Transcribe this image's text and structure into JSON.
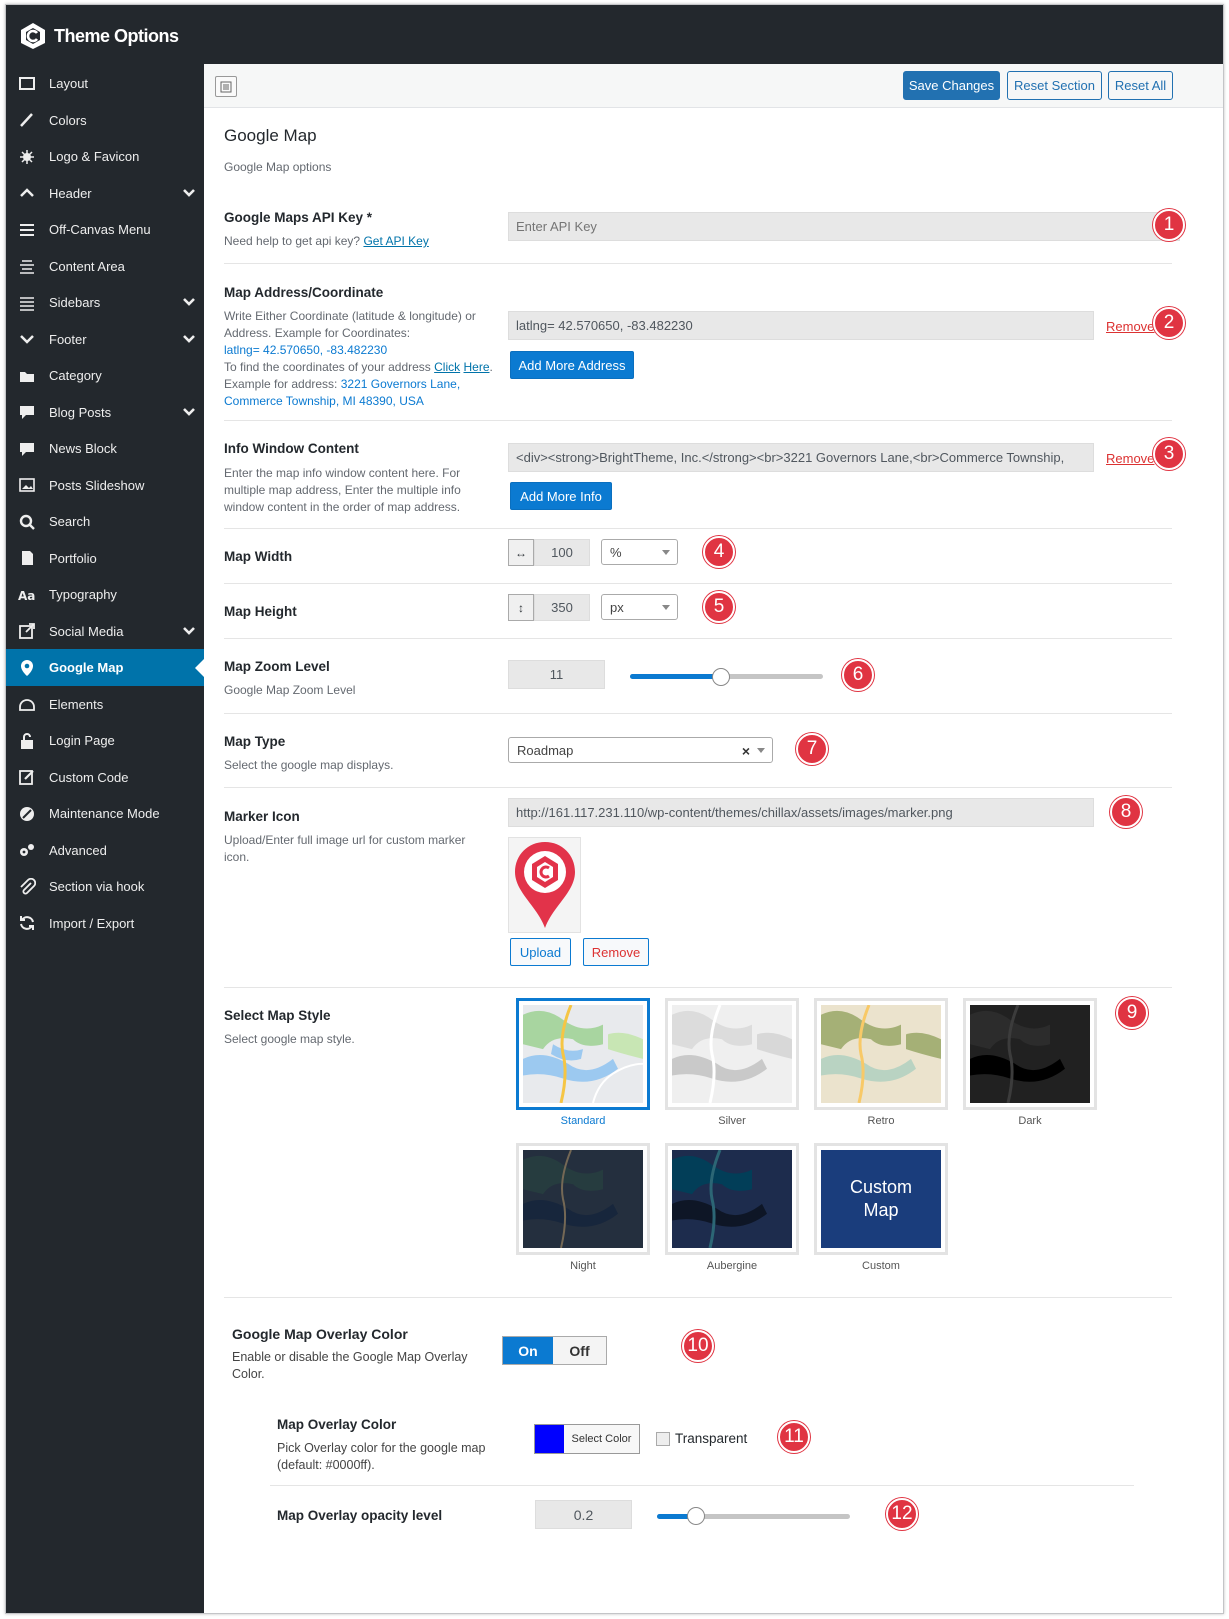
{
  "app": {
    "title": "Theme Options"
  },
  "sidebar": {
    "items": [
      {
        "label": "Layout",
        "icon": "layout-icon"
      },
      {
        "label": "Colors",
        "icon": "brush-icon"
      },
      {
        "label": "Logo & Favicon",
        "icon": "star-icon"
      },
      {
        "label": "Header",
        "icon": "arrow-up-icon",
        "expandable": true
      },
      {
        "label": "Off-Canvas Menu",
        "icon": "menu-icon"
      },
      {
        "label": "Content Area",
        "icon": "align-icon"
      },
      {
        "label": "Sidebars",
        "icon": "list-icon",
        "expandable": true
      },
      {
        "label": "Footer",
        "icon": "arrow-down-icon",
        "expandable": true
      },
      {
        "label": "Category",
        "icon": "folder-icon"
      },
      {
        "label": "Blog Posts",
        "icon": "comment-icon",
        "expandable": true
      },
      {
        "label": "News Block",
        "icon": "comment-icon"
      },
      {
        "label": "Posts Slideshow",
        "icon": "image-icon"
      },
      {
        "label": "Search",
        "icon": "search-icon"
      },
      {
        "label": "Portfolio",
        "icon": "portfolio-icon"
      },
      {
        "label": "Typography",
        "icon": "typography-icon"
      },
      {
        "label": "Social Media",
        "icon": "share-icon",
        "expandable": true
      },
      {
        "label": "Google Map",
        "icon": "location-icon",
        "active": true
      },
      {
        "label": "Elements",
        "icon": "elements-icon"
      },
      {
        "label": "Login Page",
        "icon": "lock-icon"
      },
      {
        "label": "Custom Code",
        "icon": "edit-icon"
      },
      {
        "label": "Maintenance Mode",
        "icon": "disabled-icon"
      },
      {
        "label": "Advanced",
        "icon": "gears-icon"
      },
      {
        "label": "Section via hook",
        "icon": "paperclip-icon"
      },
      {
        "label": "Import / Export",
        "icon": "refresh-icon"
      }
    ]
  },
  "toolbar": {
    "save_label": "Save Changes",
    "reset_section_label": "Reset Section",
    "reset_all_label": "Reset All"
  },
  "section": {
    "title": "Google Map",
    "subtitle": "Google Map options"
  },
  "api_key": {
    "label": "Google Maps API Key *",
    "help_prefix": "Need help to get api key?",
    "help_link": "Get API Key",
    "placeholder": "Enter API Key",
    "badge": "1"
  },
  "address": {
    "label": "Map Address/Coordinate",
    "desc1": "Write Either Coordinate (latitude & longitude) or Address. Example for Coordinates:",
    "example_coord": "latlng= 42.570650, -83.482230",
    "desc2": "To find the coordinates of your address",
    "click": "Click",
    "here": "Here",
    "desc3": ". Example for address:",
    "example_address": "3221 Governors Lane, Commerce Township, MI 48390, USA",
    "value": "latlng= 42.570650, -83.482230",
    "remove": "Remove",
    "add_button": "Add More Address",
    "badge": "2"
  },
  "info_window": {
    "label": "Info Window Content",
    "desc": "Enter the map info window content here. For multiple map address, Enter the multiple info window content in the order of map address.",
    "value": "<div><strong>BrightTheme, Inc.</strong><br>3221 Governors Lane,<br>Commerce Township,",
    "remove": "Remove",
    "add_button": "Add More Info",
    "badge": "3"
  },
  "width": {
    "label": "Map Width",
    "value": "100",
    "unit": "%",
    "badge": "4"
  },
  "height": {
    "label": "Map Height",
    "value": "350",
    "unit": "px",
    "badge": "5"
  },
  "zoom": {
    "label": "Map Zoom Level",
    "desc": "Google Map Zoom Level",
    "value": "11",
    "fraction": 0.47,
    "badge": "6"
  },
  "map_type": {
    "label": "Map Type",
    "desc": "Select the google map displays.",
    "value": "Roadmap",
    "clear": "×",
    "badge": "7"
  },
  "marker": {
    "label": "Marker Icon",
    "desc": "Upload/Enter full image url for custom marker icon.",
    "url": "http://161.117.231.110/wp-content/themes/chillax/assets/images/marker.png",
    "upload": "Upload",
    "remove": "Remove",
    "badge": "8"
  },
  "map_style": {
    "label": "Select Map Style",
    "desc": "Select google map style.",
    "badge": "9",
    "styles": [
      {
        "name": "Standard",
        "selected": true
      },
      {
        "name": "Silver"
      },
      {
        "name": "Retro"
      },
      {
        "name": "Dark"
      },
      {
        "name": "Night"
      },
      {
        "name": "Aubergine"
      },
      {
        "name": "Custom",
        "text": "Custom Map"
      }
    ]
  },
  "overlay": {
    "label": "Google Map Overlay Color",
    "desc": "Enable or disable the Google Map Overlay Color.",
    "on": "On",
    "off": "Off",
    "badge": "10"
  },
  "overlay_color": {
    "label": "Map Overlay Color",
    "desc": "Pick Overlay color for the google map (default: #0000ff).",
    "swatch": "#0000ff",
    "select": "Select Color",
    "transparent": "Transparent",
    "badge": "11"
  },
  "opacity": {
    "label": "Map Overlay opacity level",
    "value": "0.2",
    "fraction": 0.2,
    "badge": "12"
  },
  "colors": {
    "accent": "#0b7ad1",
    "sidebar": "#23282d",
    "badge": "#e03442",
    "remove": "#dc3232"
  }
}
